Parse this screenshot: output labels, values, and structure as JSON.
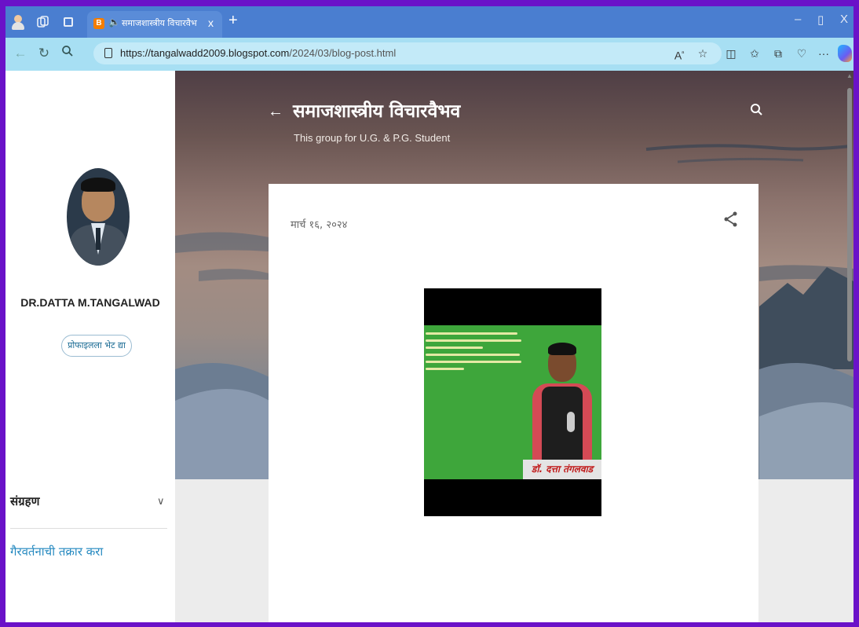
{
  "browser": {
    "tab": {
      "title": "समाजशास्त्रीय विचारवैभव",
      "close_label": "x"
    },
    "new_tab_label": "+",
    "window_controls": {
      "minimize": "–",
      "restore": "▯",
      "close": "X"
    },
    "url": {
      "host": "https://tangalwadd2009.blogspot.com",
      "path": "/2024/03/blog-post.html"
    },
    "toolbar_icons": [
      "read-aloud-icon",
      "favorite-star-icon",
      "split-screen-icon",
      "favorites-icon",
      "collections-icon",
      "browser-essentials-icon",
      "more-menu-icon",
      "copilot-icon"
    ],
    "colors": {
      "tab_strip": "#4a7ed0",
      "address_bar": "#a7dff3",
      "frame": "#6a12c8"
    }
  },
  "blog": {
    "title": "समाजशास्त्रीय विचारवैभव",
    "subtitle": "This group for U.G. & P.G. Student"
  },
  "sidebar": {
    "profile_name": "DR.DATTA M.TANGALWAD",
    "visit_profile_label": "प्रोफाइलला भेट द्या",
    "archive_label": "संग्रहण",
    "report_abuse_label": "गैरवर्तनाची तक्रार करा"
  },
  "post": {
    "date": "मार्च १६, २०२४",
    "image_caption": "डॉ. दत्ता तंगलवाड"
  }
}
